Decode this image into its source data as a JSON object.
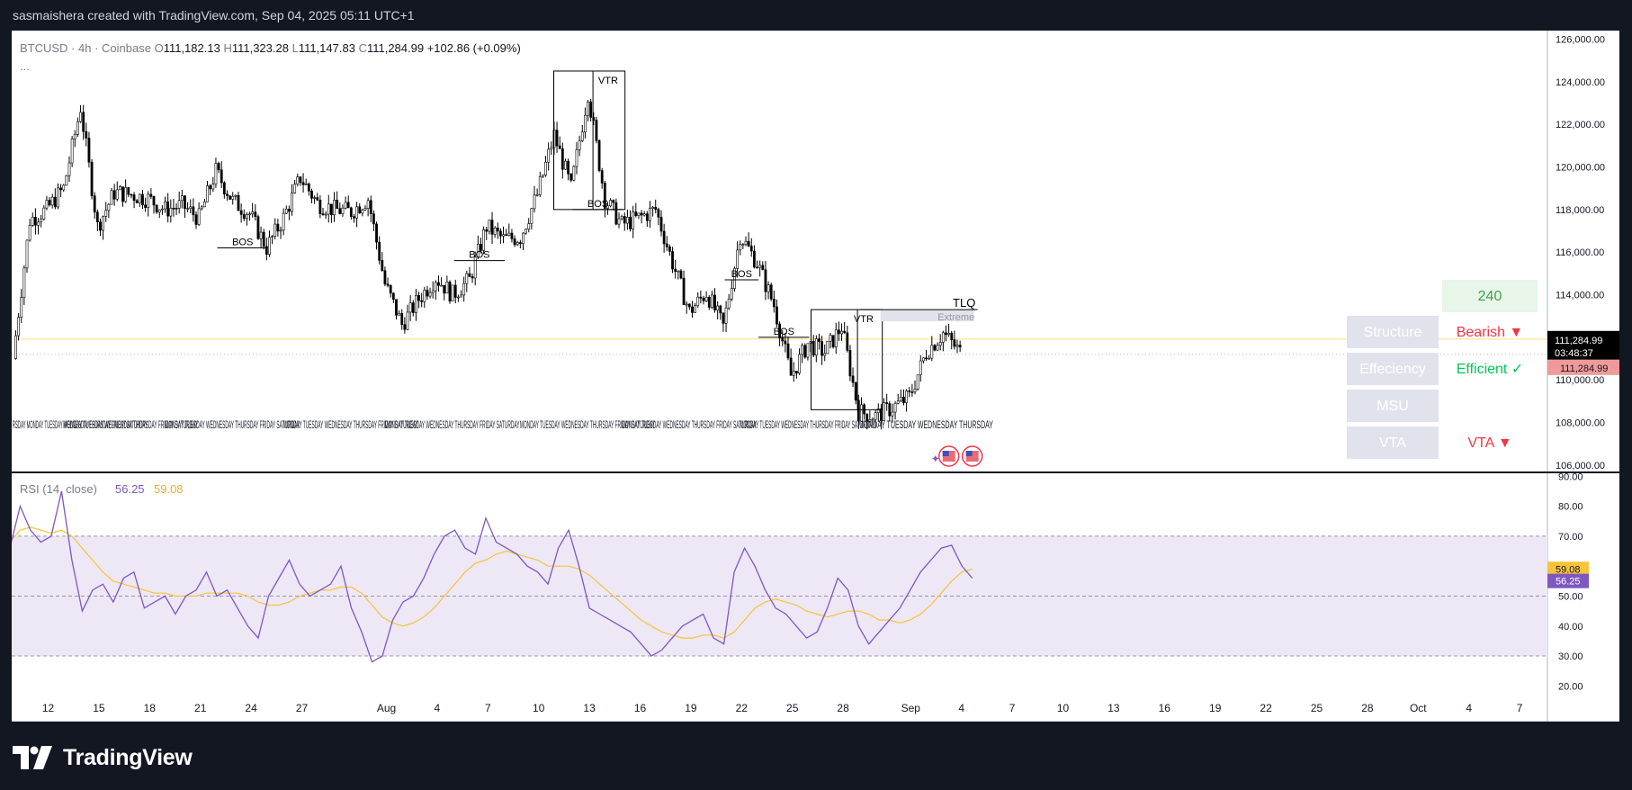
{
  "header": {
    "attribution": "sasmaishera created with TradingView.com, Sep 04, 2025 05:11 UTC+1"
  },
  "footer": {
    "brand": "TradingView"
  },
  "colors": {
    "candle": "#000000",
    "rsi_line": "#7e57c2",
    "rsi_ma": "#f7c33b",
    "rsi_band": "#ede7f6",
    "price_line": "#ffe082",
    "bearish": "#f23645",
    "efficient": "#00c853",
    "label_bg": "#e0e3eb",
    "count_bg": "#e8f5e9",
    "count_text": "#43a047"
  },
  "chart_data": [
    {
      "type": "candlestick",
      "symbol": "BTCUSD · 4h · Coinbase",
      "ohlc": {
        "O": "111,182.13",
        "H": "111,323.28",
        "L": "111,147.83",
        "C": "111,284.99",
        "change": "+102.86 (+0.09%)"
      },
      "more": "...",
      "x_ticks": [
        "12",
        "15",
        "18",
        "21",
        "24",
        "27",
        "Aug",
        "4",
        "7",
        "10",
        "13",
        "16",
        "19",
        "22",
        "25",
        "28",
        "Sep",
        "4",
        "7",
        "10",
        "13",
        "16",
        "19",
        "22",
        "25",
        "28",
        "Oct",
        "4",
        "7"
      ],
      "y_ticks": [
        "126,000.00",
        "124,000.00",
        "122,000.00",
        "120,000.00",
        "118,000.00",
        "116,000.00",
        "114,000.00",
        "112,000.00",
        "110,000.00",
        "108,000.00",
        "106,000.00"
      ],
      "ylim": [
        105700,
        126400
      ],
      "last_price": "111,284.99",
      "countdown": "03:48:37",
      "bid_label": "111,284.99",
      "approx_close_path": [
        {
          "x": "Jul 10",
          "y": 111000
        },
        {
          "x": "Jul 11",
          "y": 117500
        },
        {
          "x": "Jul 12",
          "y": 118000
        },
        {
          "x": "Jul 13",
          "y": 119000
        },
        {
          "x": "Jul 14",
          "y": 122800
        },
        {
          "x": "Jul 15",
          "y": 117200
        },
        {
          "x": "Jul 16",
          "y": 118800
        },
        {
          "x": "Jul 17",
          "y": 118700
        },
        {
          "x": "Jul 18",
          "y": 118500
        },
        {
          "x": "Jul 19",
          "y": 118000
        },
        {
          "x": "Jul 20",
          "y": 118200
        },
        {
          "x": "Jul 21",
          "y": 117600
        },
        {
          "x": "Jul 22",
          "y": 119800
        },
        {
          "x": "Jul 23",
          "y": 118400
        },
        {
          "x": "Jul 24",
          "y": 117800
        },
        {
          "x": "Jul 25",
          "y": 116200
        },
        {
          "x": "Jul 26",
          "y": 117600
        },
        {
          "x": "Jul 27",
          "y": 119500
        },
        {
          "x": "Jul 28",
          "y": 118300
        },
        {
          "x": "Jul 29",
          "y": 118000
        },
        {
          "x": "Jul 30",
          "y": 117900
        },
        {
          "x": "Jul 31",
          "y": 118500
        },
        {
          "x": "Aug 1",
          "y": 114500
        },
        {
          "x": "Aug 2",
          "y": 112600
        },
        {
          "x": "Aug 3",
          "y": 113800
        },
        {
          "x": "Aug 4",
          "y": 114800
        },
        {
          "x": "Aug 5",
          "y": 114000
        },
        {
          "x": "Aug 6",
          "y": 114700
        },
        {
          "x": "Aug 7",
          "y": 117200
        },
        {
          "x": "Aug 8",
          "y": 116600
        },
        {
          "x": "Aug 9",
          "y": 116700
        },
        {
          "x": "Aug 10",
          "y": 118700
        },
        {
          "x": "Aug 11",
          "y": 121500
        },
        {
          "x": "Aug 12",
          "y": 119000
        },
        {
          "x": "Aug 13",
          "y": 123500
        },
        {
          "x": "Aug 14",
          "y": 118500
        },
        {
          "x": "Aug 15",
          "y": 117300
        },
        {
          "x": "Aug 16",
          "y": 117600
        },
        {
          "x": "Aug 17",
          "y": 118000
        },
        {
          "x": "Aug 18",
          "y": 115500
        },
        {
          "x": "Aug 19",
          "y": 113200
        },
        {
          "x": "Aug 20",
          "y": 114100
        },
        {
          "x": "Aug 21",
          "y": 112500
        },
        {
          "x": "Aug 22",
          "y": 116800
        },
        {
          "x": "Aug 23",
          "y": 115500
        },
        {
          "x": "Aug 24",
          "y": 113500
        },
        {
          "x": "Aug 25",
          "y": 110200
        },
        {
          "x": "Aug 26",
          "y": 111700
        },
        {
          "x": "Aug 27",
          "y": 111300
        },
        {
          "x": "Aug 28",
          "y": 112500
        },
        {
          "x": "Aug 29",
          "y": 108500
        },
        {
          "x": "Aug 30",
          "y": 108300
        },
        {
          "x": "Aug 31",
          "y": 108700
        },
        {
          "x": "Sep 1",
          "y": 109200
        },
        {
          "x": "Sep 2",
          "y": 111300
        },
        {
          "x": "Sep 3",
          "y": 112200
        },
        {
          "x": "Sep 4",
          "y": 111300
        }
      ],
      "annotations": [
        {
          "text": "BOS",
          "type": "structure"
        },
        {
          "text": "BOS",
          "type": "structure"
        },
        {
          "text": "BOS",
          "type": "structure"
        },
        {
          "text": "BOS",
          "type": "structure"
        },
        {
          "text": "BOS",
          "type": "structure"
        },
        {
          "text": "VTR",
          "type": "zone"
        },
        {
          "text": "VTR",
          "type": "zone"
        },
        {
          "text": "TLQ",
          "type": "liquidity"
        },
        {
          "text": "Extreme",
          "type": "zone"
        }
      ],
      "day_label_text": [
        "RSDAY MONDAY TUESDAY WEDNESDAY THURSDAY FRIDAY SATURDAY",
        "MONDAY TUESDAY WEDNESDAY THURSDAY FRIDAY SATURDAY",
        "MONDAY TUESDAY WEDNESDAY THURSDAY FRIDAY SATURDAY",
        "MONDAY TUESDAY WEDNESDAY THURSDAY FRIDAY SATURDAY",
        "MONDAY TUESDAY WEDNESDAY THURSDAY FRIDAY SATURDAY",
        "MONDAY TUESDAY WEDNESDAY THURSDAY FRIDAY SATURDAY",
        "MONDAY TUESDAY WEDNESDAY THURSDAY FRIDAY SATURDAY",
        "MONDAY TUESDAY WEDNESDAY THURSDAY FRIDAY SATURDAY",
        "MONDAY TUESDAY WEDNESDAY THURSDAY"
      ]
    },
    {
      "type": "line",
      "title": "RSI (14, close)",
      "series": [
        {
          "name": "RSI",
          "last": "56.25",
          "values": [
            66,
            80,
            72,
            68,
            70,
            85,
            62,
            45,
            52,
            54,
            48,
            56,
            58,
            46,
            48,
            50,
            44,
            50,
            52,
            58,
            50,
            52,
            46,
            40,
            36,
            50,
            56,
            62,
            54,
            50,
            52,
            54,
            60,
            46,
            38,
            28,
            30,
            42,
            48,
            50,
            56,
            64,
            70,
            72,
            66,
            64,
            76,
            68,
            66,
            64,
            60,
            58,
            54,
            66,
            72,
            60,
            46,
            44,
            42,
            40,
            38,
            34,
            30,
            32,
            36,
            40,
            42,
            44,
            36,
            34,
            58,
            66,
            60,
            52,
            46,
            44,
            40,
            36,
            38,
            46,
            56,
            52,
            40,
            34,
            38,
            42,
            46,
            52,
            58,
            62,
            66,
            67,
            60,
            56
          ]
        },
        {
          "name": "RSI-MA",
          "last": "59.08",
          "values": [
            68,
            72,
            73,
            72,
            71,
            72,
            70,
            66,
            62,
            58,
            55,
            54,
            53,
            52,
            51,
            51,
            50,
            50,
            50,
            51,
            51,
            51,
            51,
            50,
            48,
            47,
            47,
            48,
            50,
            51,
            52,
            52,
            53,
            53,
            51,
            47,
            43,
            41,
            40,
            41,
            43,
            46,
            50,
            54,
            58,
            61,
            62,
            64,
            65,
            64,
            63,
            62,
            60,
            60,
            60,
            59,
            57,
            54,
            51,
            48,
            45,
            42,
            40,
            38,
            37,
            36,
            36,
            37,
            37,
            36,
            38,
            42,
            46,
            48,
            49,
            48,
            47,
            45,
            44,
            43,
            44,
            45,
            45,
            44,
            42,
            42,
            41,
            42,
            44,
            47,
            51,
            55,
            58,
            59
          ]
        }
      ],
      "y_ticks": [
        "90.00",
        "80.00",
        "70.00",
        "60.00",
        "50.00",
        "40.00",
        "30.00",
        "20.00"
      ],
      "ylim": [
        18,
        91
      ],
      "bands": [
        30,
        50,
        70
      ]
    }
  ],
  "table": {
    "count": "240",
    "rows": [
      {
        "label": "Structure",
        "value": "Bearish ▼"
      },
      {
        "label": "Effeciency",
        "value": "Efficient ✓"
      },
      {
        "label": "MSU",
        "value": ""
      },
      {
        "label": "VTA",
        "value": "VTA ▼"
      }
    ]
  }
}
